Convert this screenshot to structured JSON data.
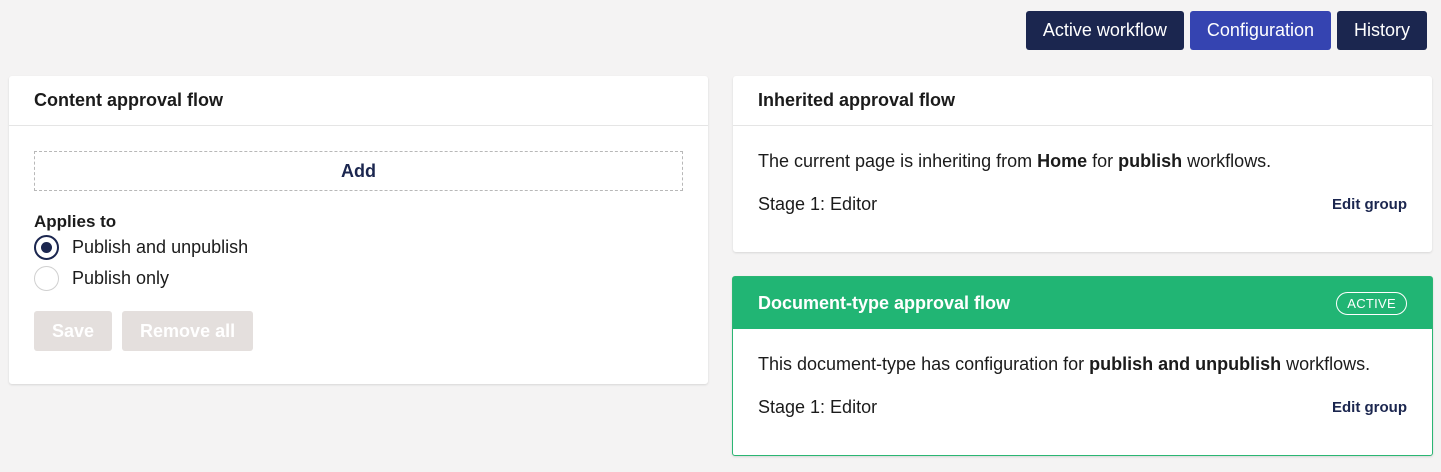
{
  "tabs": [
    {
      "label": "Active workflow"
    },
    {
      "label": "Configuration"
    },
    {
      "label": "History"
    }
  ],
  "active_tab": "Configuration",
  "content_flow": {
    "title": "Content approval flow",
    "add_label": "Add",
    "applies_to_label": "Applies to",
    "options": [
      {
        "label": "Publish and unpublish",
        "checked": true
      },
      {
        "label": "Publish only",
        "checked": false
      }
    ],
    "save_label": "Save",
    "remove_all_label": "Remove all"
  },
  "inherited_flow": {
    "title": "Inherited approval flow",
    "text_prefix": "The current page is inheriting from ",
    "source": "Home",
    "text_mid": " for ",
    "action": "publish",
    "text_suffix": " workflows.",
    "stage": "Stage 1: Editor",
    "edit_label": "Edit group"
  },
  "doctype_flow": {
    "title": "Document-type approval flow",
    "badge": "ACTIVE",
    "text_prefix": "This document-type has configuration for ",
    "action": "publish and unpublish",
    "text_suffix": " workflows.",
    "stage": "Stage 1: Editor",
    "edit_label": "Edit group"
  },
  "colors": {
    "primary": "#1b264f",
    "active_tab": "#3544b1",
    "success": "#21b574",
    "disabled": "#e4dfdd",
    "background": "#f4f3f3"
  }
}
